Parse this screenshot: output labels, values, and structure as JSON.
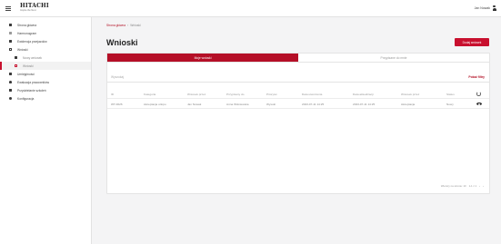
{
  "header": {
    "logo_text": "HITACHI",
    "logo_subtext": "Inspire the Next",
    "user_name": "Jan Nowak"
  },
  "sidebar": {
    "items": [
      {
        "label": "Strona główna",
        "icon": "home-icon"
      },
      {
        "label": "Harmonogram",
        "icon": "calendar-icon"
      },
      {
        "label": "Ewidencja przejazdów",
        "icon": "car-icon"
      },
      {
        "label": "Wnioski",
        "icon": "document-icon"
      },
      {
        "label": "Nowy wniosek",
        "icon": "new-document-icon"
      },
      {
        "label": "Wnioski",
        "icon": "list-icon"
      },
      {
        "label": "Umiejętności",
        "icon": "skill-icon"
      },
      {
        "label": "Ewaluacja pracowników",
        "icon": "person-icon"
      },
      {
        "label": "Przydzielanie szkoleń",
        "icon": "group-icon"
      },
      {
        "label": "Konfiguracja",
        "icon": "gear-icon"
      }
    ]
  },
  "breadcrumb": {
    "home": "Strona główna",
    "separator": "›",
    "current": "Wnioski"
  },
  "page": {
    "title": "Wnioski",
    "add_button": "Dodaj wniosek"
  },
  "tabs": [
    {
      "label": "Moje wnioski",
      "active": true
    },
    {
      "label": "Przypisane do mnie",
      "active": false
    }
  ],
  "search": {
    "placeholder": "Wyszukaj"
  },
  "filters_link": "Pokaż filtry",
  "table": {
    "columns": [
      "ID",
      "Kategoria",
      "Wniosek przez",
      "Przypisany do",
      "Priorytet",
      "Data utworzenia",
      "Data aktualizacji",
      "Wniosek przez",
      "Status"
    ],
    "rows": [
      [
        "WT-0026",
        "Akceptacja urlopu",
        "Jan Nowak",
        "Anna Wiśniewska",
        "Wysoki",
        "2023-07-11 14:25",
        "2023-07-11 14:25",
        "Akceptacja",
        "Nowy"
      ]
    ]
  },
  "pagination": {
    "rows_per_page": "Wierszy na stronie: 10",
    "range": "1-1 z 1"
  },
  "colors": {
    "accent": "#c8102e"
  }
}
